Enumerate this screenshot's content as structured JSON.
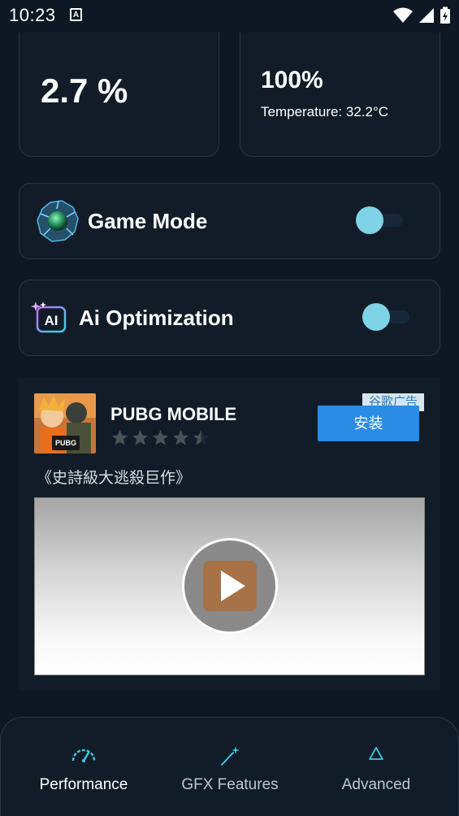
{
  "status_bar": {
    "time": "10:23",
    "notification_icon": "a-icon",
    "icons": [
      "wifi-icon",
      "signal-icon",
      "battery-charging-icon"
    ]
  },
  "stats": {
    "cpu_usage": {
      "value": "2.7 %"
    },
    "battery": {
      "value": "100%",
      "temperature": "Temperature: 32.2°C"
    }
  },
  "features": [
    {
      "title": "Game Mode",
      "icon": "game-mode-orb-icon",
      "enabled": true
    },
    {
      "title": "Ai Optimization",
      "icon": "ai-sparkle-icon",
      "enabled": true
    }
  ],
  "ad": {
    "app_name": "PUBG MOBILE",
    "badge": "谷歌广告",
    "install_label": "安装",
    "tagline": "《史詩級大逃殺巨作》",
    "rating": 4.5,
    "icon": "pubg-app-icon",
    "video_icon": "play-icon"
  },
  "nav": {
    "items": [
      {
        "label": "Performance",
        "icon": "speedometer-icon",
        "active": true
      },
      {
        "label": "GFX Features",
        "icon": "magic-wand-icon",
        "active": false
      },
      {
        "label": "Advanced",
        "icon": "triangle-icon",
        "active": false
      }
    ]
  },
  "colors": {
    "background": "#0d1824",
    "card": "#111c28",
    "accent": "#7fd3e6",
    "install_button": "#2b8ce6",
    "active_nav_icon": "#39c7e6"
  }
}
